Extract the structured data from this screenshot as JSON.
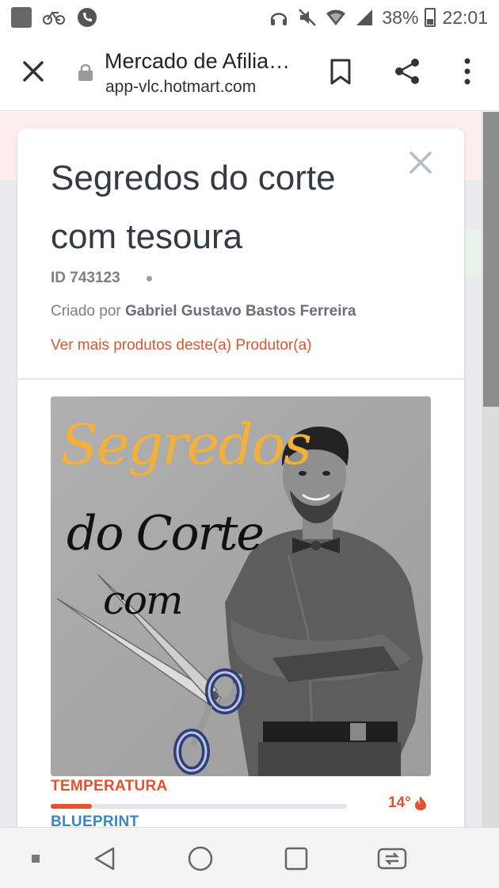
{
  "status_bar": {
    "battery": "38%",
    "time": "22:01",
    "left_icons": [
      "app-square-icon",
      "bike-icon",
      "phone-icon"
    ],
    "right_icons": [
      "headset-icon",
      "mute-icon",
      "wifi-icon",
      "signal-icon",
      "battery-icon"
    ]
  },
  "browser": {
    "page_title": "Mercado de Afilia…",
    "url": "app-vlc.hotmart.com",
    "icons": [
      "close-icon",
      "lock-icon",
      "bookmark-icon",
      "share-icon",
      "more-vert-icon"
    ]
  },
  "modal": {
    "title": "Segredos do corte com tesoura",
    "id_text": "ID 743123",
    "creator_prefix": "Criado por",
    "creator_name": "Gabriel Gustavo Bastos Ferreira",
    "more_link": "Ver mais produtos deste(a) Produtor(a)",
    "image": {
      "word1": "Segredos",
      "word2": "do Corte",
      "word3": "com"
    },
    "temperature": {
      "label": "TEMPERATURA",
      "value": "14°",
      "fill_fraction": 0.14
    },
    "blueprint_label": "BLUEPRINT"
  },
  "colors": {
    "accent": "#e0532d",
    "blueprint": "#3a86c8",
    "title": "#333b44",
    "script_gold": "#f1b13b"
  },
  "nav_bar": {
    "icons": [
      "square-dot-icon",
      "back-triangle-icon",
      "home-circle-icon",
      "recents-square-icon",
      "switch-apps-icon"
    ]
  }
}
